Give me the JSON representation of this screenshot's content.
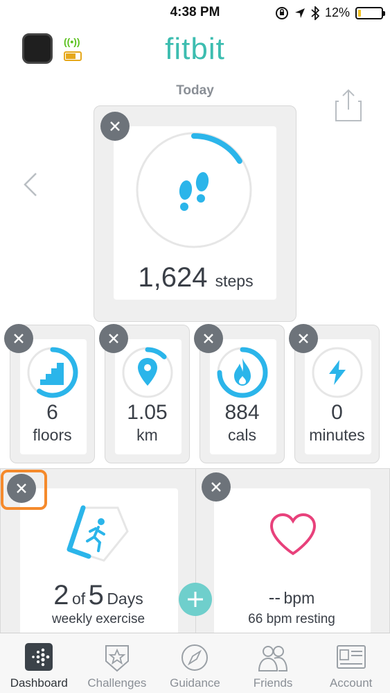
{
  "status_bar": {
    "time": "4:38 PM",
    "battery_percent": "12%",
    "battery_level": 0.12
  },
  "header": {
    "logo": "fitbit",
    "day_label": "Today",
    "colors": {
      "brand": "#3dbdb0",
      "accent_blue": "#2bb5ea",
      "heart_pink": "#e8417b",
      "highlight": "#f58a2c"
    }
  },
  "steps_tile": {
    "value": "1,624",
    "unit": "steps",
    "progress": 0.16,
    "icon": "footsteps-icon"
  },
  "small_tiles": [
    {
      "value": "6",
      "unit": "floors",
      "progress": 0.6,
      "icon": "stairs-icon"
    },
    {
      "value": "1.05",
      "unit": "km",
      "progress": 0.13,
      "icon": "location-pin-icon"
    },
    {
      "value": "884",
      "unit": "cals",
      "progress": 0.75,
      "icon": "flame-icon"
    },
    {
      "value": "0",
      "unit": "minutes",
      "progress": 0,
      "icon": "lightning-icon"
    }
  ],
  "exercise_tile": {
    "count": "2",
    "of": "of",
    "goal": "5",
    "unit": "Days",
    "subtitle": "weekly exercise",
    "progress": 0.4,
    "icon": "running-person-icon"
  },
  "heart_tile": {
    "value": "--",
    "unit": "bpm",
    "subtitle": "66 bpm resting",
    "icon": "heart-icon"
  },
  "tabs": [
    {
      "label": "Dashboard",
      "icon": "dashboard-icon",
      "active": true
    },
    {
      "label": "Challenges",
      "icon": "star-badge-icon",
      "active": false
    },
    {
      "label": "Guidance",
      "icon": "compass-icon",
      "active": false
    },
    {
      "label": "Friends",
      "icon": "friends-icon",
      "active": false
    },
    {
      "label": "Account",
      "icon": "account-card-icon",
      "active": false
    }
  ]
}
